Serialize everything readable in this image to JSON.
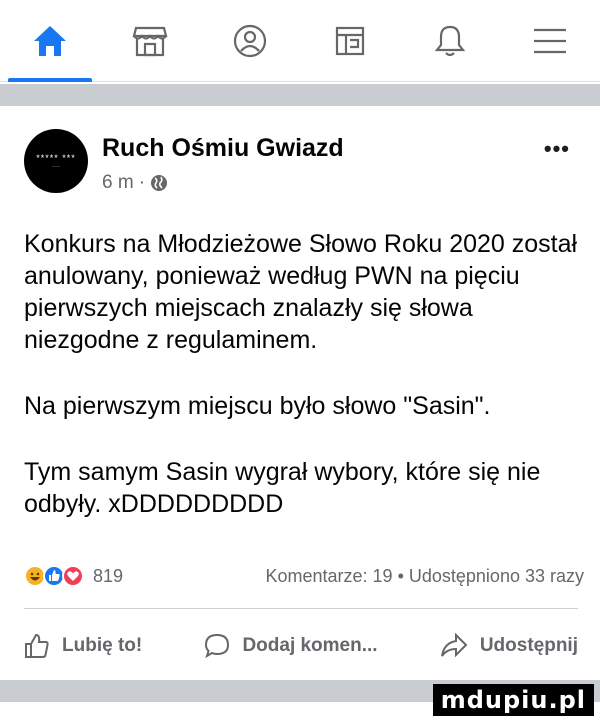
{
  "nav": {
    "tabs": [
      {
        "icon": "home-icon",
        "active": true
      },
      {
        "icon": "marketplace-icon"
      },
      {
        "icon": "groups-icon"
      },
      {
        "icon": "pages-icon"
      },
      {
        "icon": "bell-icon"
      },
      {
        "icon": "menu-icon"
      }
    ],
    "accent": "#1877f2"
  },
  "post": {
    "page_name": "Ruch Ośmiu Gwiazd",
    "avatar_text": "***** ***",
    "time": "6 m",
    "time_separator": "·",
    "audience_icon": "globe-icon",
    "more_label": "•••",
    "paragraphs": [
      "Konkurs na Młodzieżowe Słowo Roku 2020 został anulowany, ponieważ według PWN na pięciu pierwszych miejscach znalazły się słowa niezgodne z regulaminem.",
      "Na pierwszym miejscu było słowo \"Sasin\".",
      "Tym samym Sasin wygrał wybory, które się nie odbyły. xDDDDDDDDD"
    ],
    "reactions": [
      "haha",
      "like",
      "love"
    ],
    "reaction_count": "819",
    "stats_text": "Komentarze: 19 • Udostępniono 33 razy"
  },
  "actions": {
    "like_label": "Lubię to!",
    "comment_label": "Dodaj komen...",
    "share_label": "Udostępnij"
  },
  "watermark": "mdupiu.pl"
}
